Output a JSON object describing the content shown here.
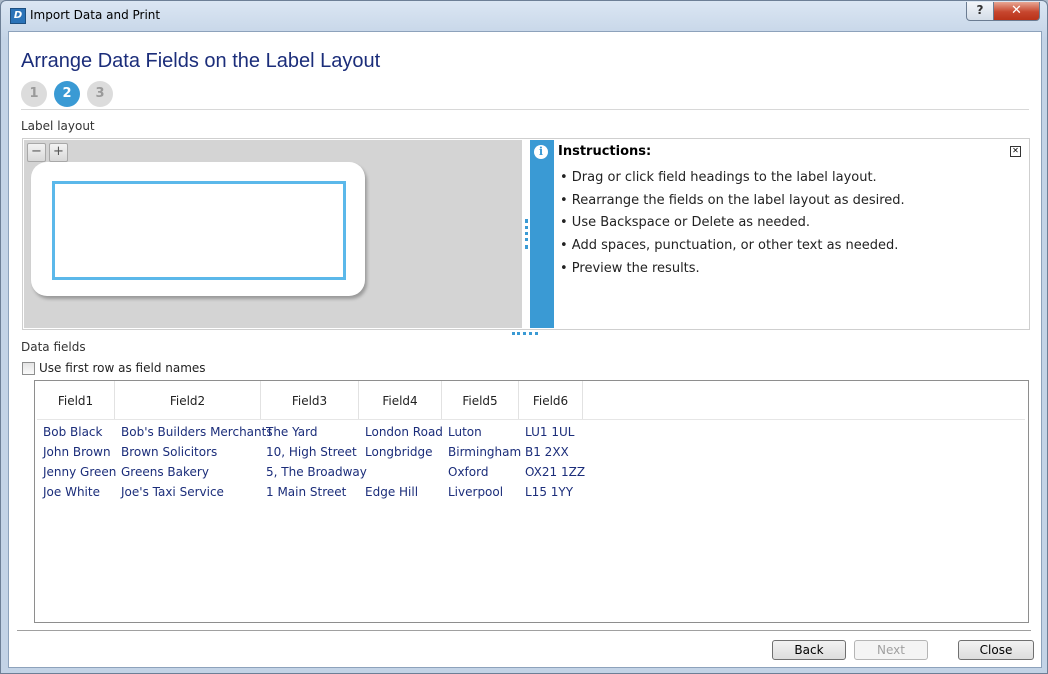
{
  "window": {
    "title": "Import Data and Print",
    "help_label": "?",
    "close_label": "✕"
  },
  "page": {
    "title": "Arrange Data Fields on the Label Layout",
    "steps": [
      "1",
      "2",
      "3"
    ],
    "active_step": 2
  },
  "label_layout": {
    "section_label": "Label layout",
    "zoom_out_label": "−",
    "zoom_in_label": "+"
  },
  "instructions": {
    "title": "Instructions:",
    "close_label": "✕",
    "icon_label": "i",
    "items": [
      "• Drag or click field headings to the label layout.",
      "• Rearrange the fields on the label layout as desired.",
      "• Use Backspace or Delete as needed.",
      "• Add spaces, punctuation, or other text as needed.",
      "• Preview the results."
    ]
  },
  "data_fields": {
    "section_label": "Data fields",
    "use_first_row_label": "Use first row as field names",
    "use_first_row_checked": false,
    "headers": [
      "Field1",
      "Field2",
      "Field3",
      "Field4",
      "Field5",
      "Field6"
    ],
    "rows": [
      [
        "Bob Black",
        "Bob's Builders Merchants",
        "The Yard",
        "London Road",
        "Luton",
        "LU1 1UL"
      ],
      [
        "John Brown",
        "Brown Solicitors",
        "10, High Street",
        "Longbridge",
        "Birmingham",
        "B1 2XX"
      ],
      [
        "Jenny Green",
        "Greens Bakery",
        "5, The Broadway",
        "",
        "Oxford",
        "OX21 1ZZ"
      ],
      [
        "Joe White",
        "Joe's Taxi Service",
        "1 Main Street",
        "Edge Hill",
        "Liverpool",
        "L15 1YY"
      ]
    ]
  },
  "footer": {
    "back_label": "Back",
    "next_label": "Next",
    "close_label": "Close"
  },
  "colors": {
    "accent": "#3a9ad4",
    "title": "#1b2d7a",
    "label_border": "#5bb8ea"
  },
  "icons": {
    "app": "app-logo-icon",
    "info": "info-icon",
    "zoom_out": "zoom-out-icon",
    "zoom_in": "zoom-in-icon"
  }
}
